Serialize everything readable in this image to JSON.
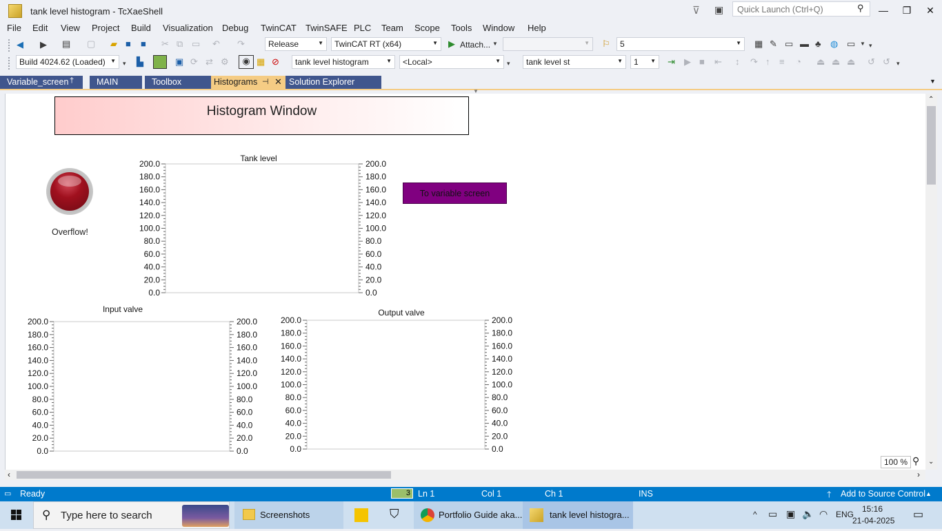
{
  "window": {
    "title": "tank level histogram - TcXaeShell",
    "quick_launch_placeholder": "Quick Launch (Ctrl+Q)"
  },
  "menu": [
    "File",
    "Edit",
    "View",
    "Project",
    "Build",
    "Visualization",
    "Debug",
    "TwinCAT",
    "TwinSAFE",
    "PLC",
    "Team",
    "Scope",
    "Tools",
    "Window",
    "Help"
  ],
  "toolbar1": {
    "configuration": "Release",
    "platform": "TwinCAT RT (x64)",
    "attach_label": "Attach...",
    "find_value": "5"
  },
  "toolbar2": {
    "build_label": "Build 4024.62 (Loaded)",
    "visualization_combo": "tank level histogram",
    "target_combo": "<Local>",
    "instance_combo": "tank level st",
    "instance_number": "1"
  },
  "tabs": [
    {
      "label": "Variable_screen",
      "pin": "†"
    },
    {
      "label": "MAIN"
    },
    {
      "label": "Toolbox"
    },
    {
      "label": "Histograms",
      "pin": "⊣",
      "close": "✕"
    },
    {
      "label": "Solution Explorer"
    }
  ],
  "visualization": {
    "header_title": "Histogram Window",
    "overflow_label": "Overflow!",
    "to_variable_button": "To variable screen",
    "colors": {
      "header_start": "#ffcccc",
      "button": "#800080",
      "lamp": "#8b0a1a"
    }
  },
  "chart_data": [
    {
      "type": "bar",
      "title": "Tank level",
      "ylim": [
        0,
        200
      ],
      "yticks": [
        "0.0",
        "20.0",
        "40.0",
        "60.0",
        "80.0",
        "100.0",
        "120.0",
        "140.0",
        "160.0",
        "180.0",
        "200.0"
      ],
      "series": [],
      "axes": "left-and-right"
    },
    {
      "type": "bar",
      "title": "Input valve",
      "ylim": [
        0,
        200
      ],
      "yticks": [
        "0.0",
        "20.0",
        "40.0",
        "60.0",
        "80.0",
        "100.0",
        "120.0",
        "140.0",
        "160.0",
        "180.0",
        "200.0"
      ],
      "series": [],
      "axes": "left-and-right"
    },
    {
      "type": "bar",
      "title": "Output valve",
      "ylim": [
        0,
        200
      ],
      "yticks": [
        "0.0",
        "20.0",
        "40.0",
        "60.0",
        "80.0",
        "100.0",
        "120.0",
        "140.0",
        "160.0",
        "180.0",
        "200.0"
      ],
      "series": [],
      "axes": "left-and-right"
    }
  ],
  "zoom": "100 %",
  "status": {
    "ready": "Ready",
    "badge": "3",
    "ln": "Ln 1",
    "col": "Col 1",
    "ch": "Ch 1",
    "ins": "INS",
    "source_control": "Add to Source Control"
  },
  "taskbar": {
    "search_placeholder": "Type here to search",
    "items": [
      "Screenshots",
      "Portfolio Guide aka...",
      "tank level histogra..."
    ],
    "lang": "ENG",
    "time": "15:16",
    "date": "21-04-2025"
  },
  "colors": {
    "statusbar": "#007acc",
    "tab_active": "#f5cc84",
    "tab_inactive": "#40568d"
  }
}
